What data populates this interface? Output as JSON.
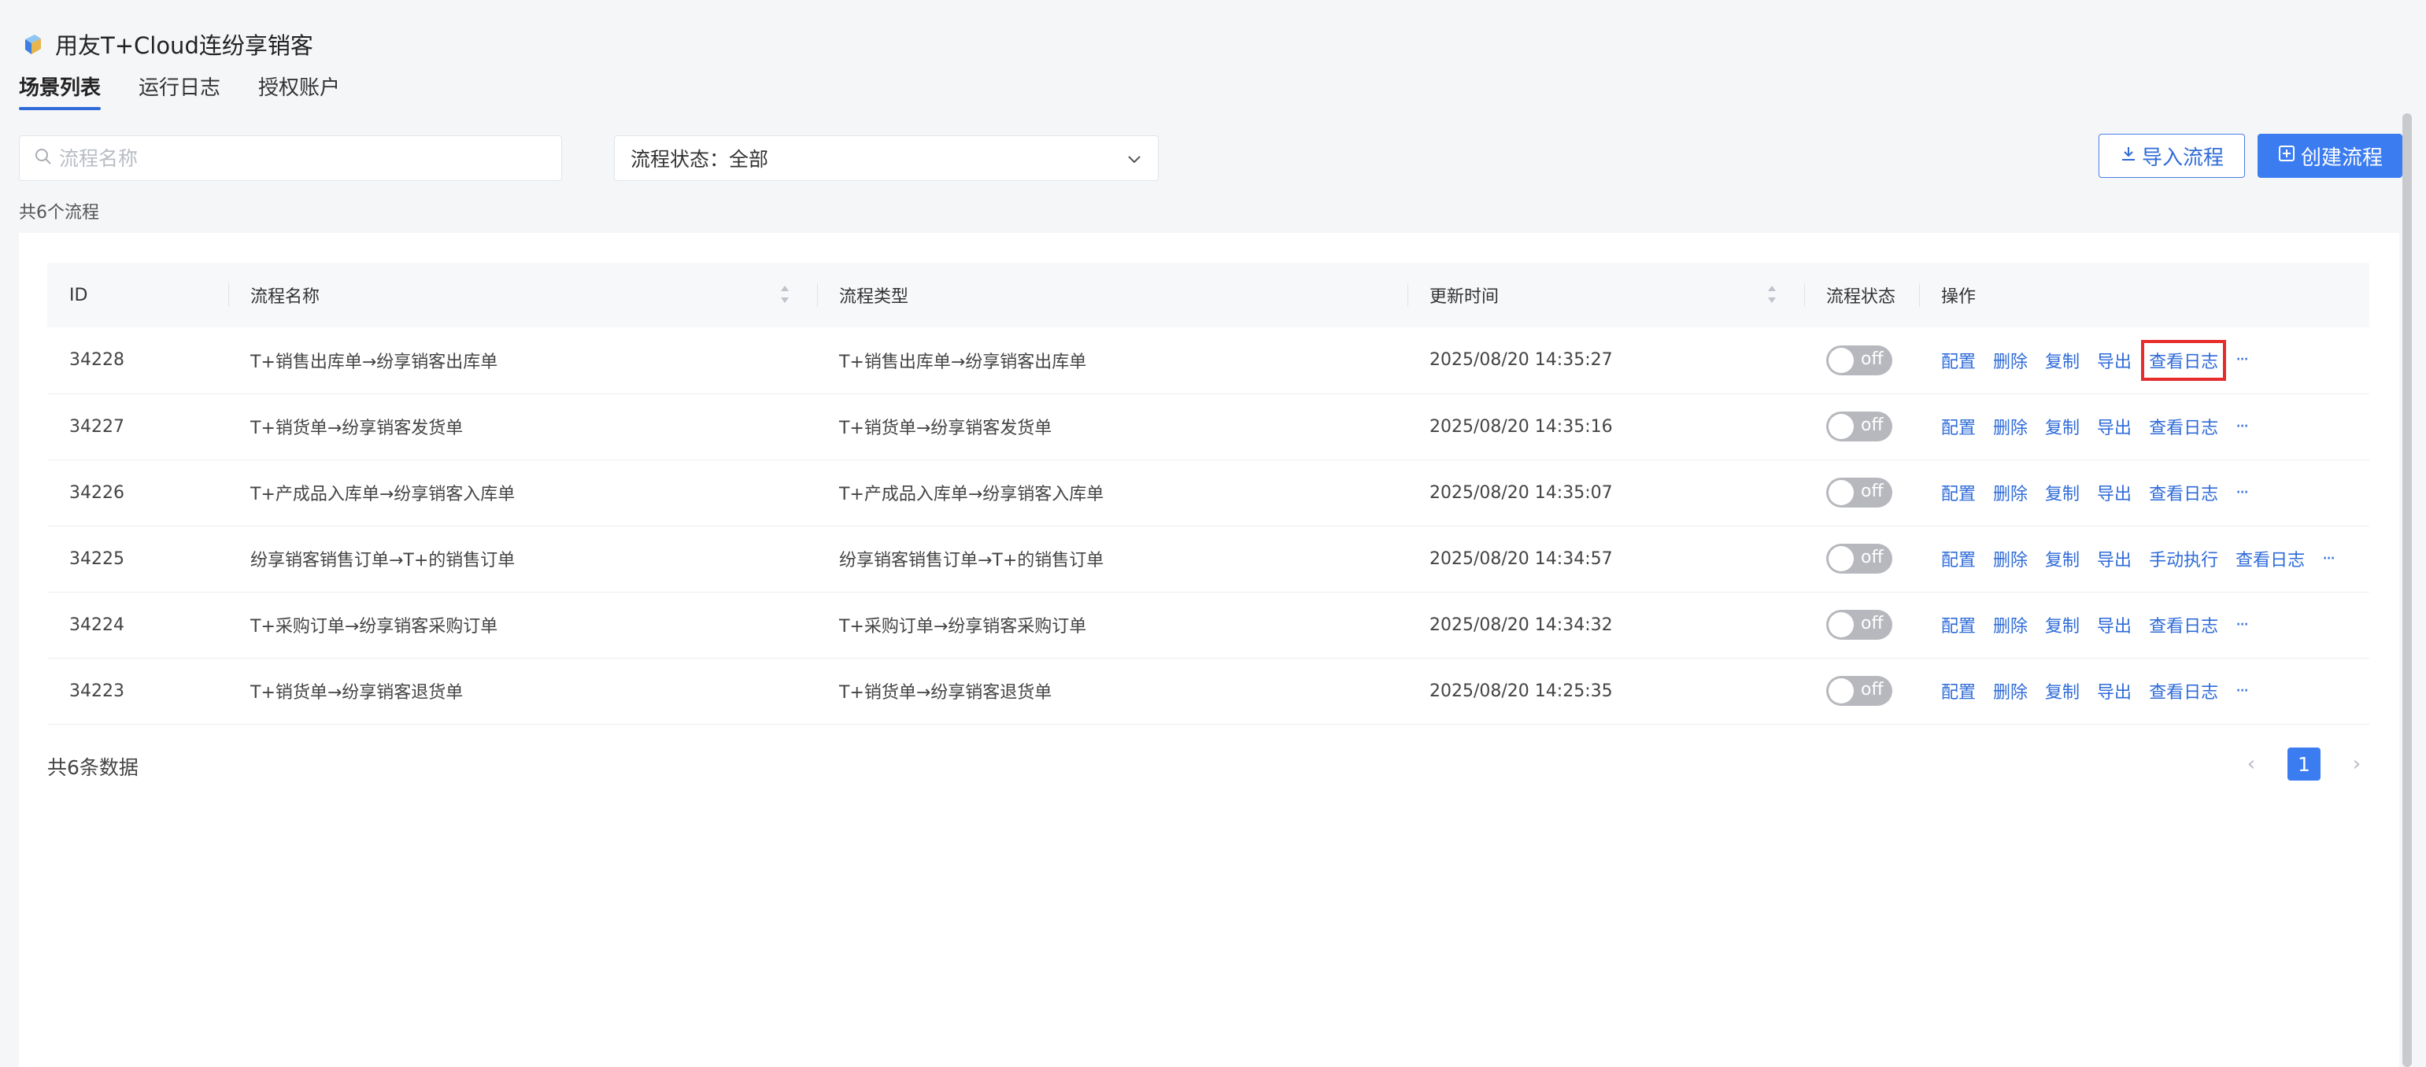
{
  "app": {
    "title": "用友T+Cloud连纷享销客"
  },
  "tabs": [
    {
      "label": "场景列表",
      "active": true
    },
    {
      "label": "运行日志",
      "active": false
    },
    {
      "label": "授权账户",
      "active": false
    }
  ],
  "search": {
    "placeholder": "流程名称",
    "value": ""
  },
  "status_filter": {
    "label": "流程状态：",
    "value": "全部"
  },
  "buttons": {
    "import": "导入流程",
    "create": "创建流程"
  },
  "flow_count": "共6个流程",
  "table": {
    "columns": [
      "ID",
      "流程名称",
      "流程类型",
      "更新时间",
      "流程状态",
      "操作"
    ],
    "toggle_label": "off",
    "rows": [
      {
        "id": "34228",
        "name": "T+销售出库单→纷享销客出库单",
        "type": "T+销售出库单→纷享销客出库单",
        "updated": "2025/08/20 14:35:27",
        "status": "off",
        "ops": [
          "配置",
          "删除",
          "复制",
          "导出",
          "查看日志"
        ]
      },
      {
        "id": "34227",
        "name": "T+销货单→纷享销客发货单",
        "type": "T+销货单→纷享销客发货单",
        "updated": "2025/08/20 14:35:16",
        "status": "off",
        "ops": [
          "配置",
          "删除",
          "复制",
          "导出",
          "查看日志"
        ]
      },
      {
        "id": "34226",
        "name": "T+产成品入库单→纷享销客入库单",
        "type": "T+产成品入库单→纷享销客入库单",
        "updated": "2025/08/20 14:35:07",
        "status": "off",
        "ops": [
          "配置",
          "删除",
          "复制",
          "导出",
          "查看日志"
        ]
      },
      {
        "id": "34225",
        "name": "纷享销客销售订单→T+的销售订单",
        "type": "纷享销客销售订单→T+的销售订单",
        "updated": "2025/08/20 14:34:57",
        "status": "off",
        "ops": [
          "配置",
          "删除",
          "复制",
          "导出",
          "手动执行",
          "查看日志"
        ]
      },
      {
        "id": "34224",
        "name": "T+采购订单→纷享销客采购订单",
        "type": "T+采购订单→纷享销客采购订单",
        "updated": "2025/08/20 14:34:32",
        "status": "off",
        "ops": [
          "配置",
          "删除",
          "复制",
          "导出",
          "查看日志"
        ]
      },
      {
        "id": "34223",
        "name": "T+销货单→纷享销客退货单",
        "type": "T+销货单→纷享销客退货单",
        "updated": "2025/08/20 14:25:35",
        "status": "off",
        "ops": [
          "配置",
          "删除",
          "复制",
          "导出",
          "查看日志"
        ]
      }
    ]
  },
  "pagination": {
    "total_text": "共6条数据",
    "current_page": "1"
  },
  "colors": {
    "accent": "#3b7cf0",
    "link": "#2f6bd8",
    "highlight": "#e62c2c",
    "toggle_off": "#b6b8bd"
  },
  "icons": {
    "logo": "cube-logo-icon",
    "search": "search-icon",
    "dropdown": "chevron-down-icon",
    "import": "download-icon",
    "create": "plus-square-icon",
    "more": "ellipsis-icon"
  }
}
